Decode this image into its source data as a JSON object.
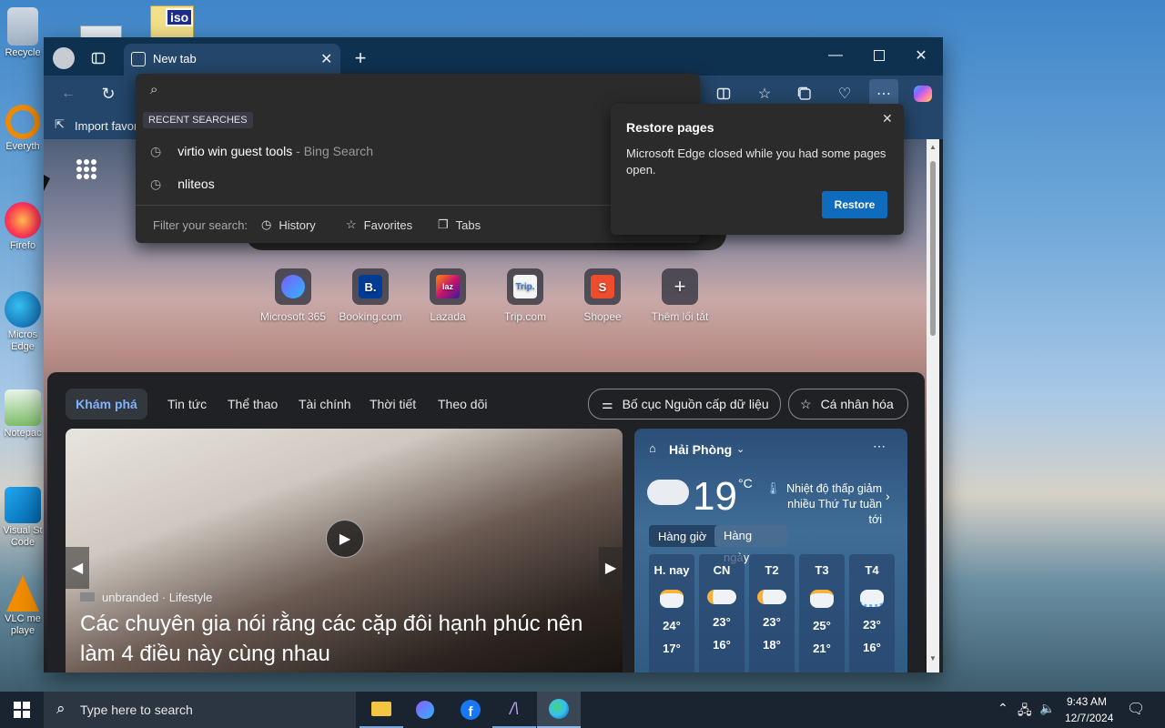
{
  "desktop": {
    "icons": [
      {
        "label": "Recycle"
      },
      {
        "label": "Everyth"
      },
      {
        "label": "Firefo"
      },
      {
        "label": "Micros Edge"
      },
      {
        "label": "Notepac"
      },
      {
        "label": "Visual St Code"
      },
      {
        "label": "VLC me playe"
      }
    ],
    "iso_label": "iso"
  },
  "browser": {
    "tab_title": "New tab",
    "favbar_import": "Import favor",
    "omnibox_value": "",
    "dropdown": {
      "header": "RECENT SEARCHES",
      "items": [
        {
          "text": "virtio win guest tools",
          "suffix": " - Bing Search"
        },
        {
          "text": "nliteos",
          "suffix": ""
        }
      ],
      "filter_label": "Filter your search:",
      "filters": [
        "History",
        "Favorites",
        "Tabs"
      ]
    },
    "restore": {
      "title": "Restore pages",
      "message": "Microsoft Edge closed while you had some pages open.",
      "button": "Restore"
    },
    "shortcuts": [
      {
        "label": "Microsoft 365",
        "color": "#6b4cc4",
        "glyph": "◉"
      },
      {
        "label": "Booking.com",
        "color": "#003b95",
        "glyph": "B."
      },
      {
        "label": "Lazada",
        "color": "#c8146f",
        "glyph": "laz"
      },
      {
        "label": "Trip.com",
        "color": "#f4f4f4",
        "glyph": "Trip."
      },
      {
        "label": "Shopee",
        "color": "#ee4d2d",
        "glyph": "S"
      },
      {
        "label": "Thêm lối tắt",
        "color": "#5a5a60",
        "glyph": "+"
      }
    ],
    "feed": {
      "tabs": [
        "Khám phá",
        "Tin tức",
        "Thể thao",
        "Tài chính",
        "Thời tiết",
        "Theo dõi"
      ],
      "layout_btn": "Bố cục Nguồn cấp dữ liệu",
      "personalize_btn": "Cá nhân hóa",
      "article": {
        "source": "unbranded · Lifestyle",
        "title": "Các chuyên gia nói rằng các cặp đôi hạnh phúc nên làm 4 điều này cùng nhau"
      },
      "weather": {
        "location": "Hải Phòng",
        "temp": "19",
        "unit": "°C",
        "alert": "Nhiệt độ thấp giảm nhiều Thứ Tư tuần tới",
        "mode_hourly": "Hàng giờ",
        "mode_daily": "Hàng ngày",
        "days": [
          {
            "label": "H. nay",
            "hi": "24°",
            "lo": "17°"
          },
          {
            "label": "CN",
            "hi": "23°",
            "lo": "16°"
          },
          {
            "label": "T2",
            "hi": "23°",
            "lo": "18°"
          },
          {
            "label": "T3",
            "hi": "25°",
            "lo": "21°"
          },
          {
            "label": "T4",
            "hi": "23°",
            "lo": "16°"
          }
        ]
      }
    }
  },
  "taskbar": {
    "search_placeholder": "Type here to search",
    "time": "9:43 AM",
    "date": "12/7/2024"
  }
}
